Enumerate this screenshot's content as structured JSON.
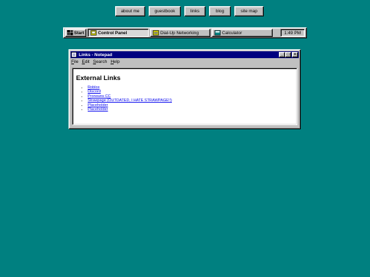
{
  "nav": [
    {
      "label": "about me"
    },
    {
      "label": "guestbook"
    },
    {
      "label": "links"
    },
    {
      "label": "blog"
    },
    {
      "label": "site map"
    }
  ],
  "taskbar": {
    "start_label": "Start",
    "items": [
      {
        "label": "Control Panel",
        "icon": "control-panel-icon",
        "active": true
      },
      {
        "label": "Dial-Up Networking",
        "icon": "dialup-icon"
      },
      {
        "label": "Calculator",
        "icon": "calculator-icon"
      }
    ],
    "clock": "1:49 PM"
  },
  "window": {
    "title": "Links - Notepad",
    "menu": [
      {
        "label": "File",
        "accel": "F",
        "rest": "ile"
      },
      {
        "label": "Edit",
        "accel": "E",
        "rest": "dit"
      },
      {
        "label": "Search",
        "accel": "S",
        "rest": "earch"
      },
      {
        "label": "Help",
        "accel": "H",
        "rest": "elp"
      }
    ],
    "controls": {
      "minimize": "_",
      "maximize": "□",
      "close": "×"
    },
    "heading": "External Links",
    "links": [
      "Roblox",
      "Discord",
      "Pronouns CC",
      "Strawpage (OUTDATED, I HATE STRAWPAGE!!)",
      "Placeholder",
      "Placeholder"
    ]
  },
  "colors": {
    "desktop": "#008080",
    "titlebar": "#000080",
    "link": "#0000ee"
  }
}
